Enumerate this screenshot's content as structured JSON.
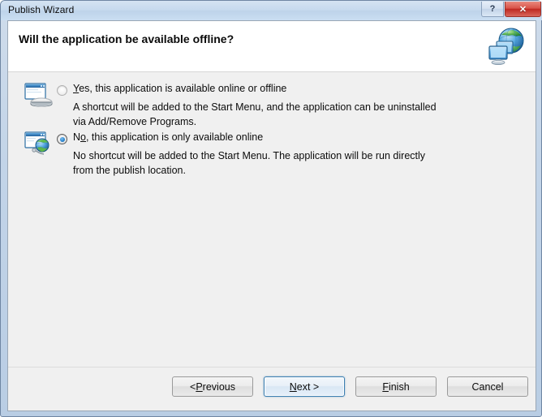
{
  "window": {
    "title": "Publish Wizard",
    "titlebar_buttons": [
      {
        "name": "help",
        "glyph": "?"
      },
      {
        "name": "close",
        "glyph": "✕"
      }
    ]
  },
  "header": {
    "title": "Will the application be available offline?",
    "icon": "network-globe-icon"
  },
  "options": [
    {
      "icon": "computer-disk-icon",
      "label_prefix": "",
      "label_accel": "Y",
      "label_rest": "es, this application is available online or offline",
      "description": "A shortcut will be added to the Start Menu, and the application can be uninstalled via Add/Remove Programs.",
      "selected": false
    },
    {
      "icon": "computer-globe-icon",
      "label_prefix": "N",
      "label_accel": "o",
      "label_rest": ", this application is only available online",
      "description": "No shortcut will be added to the Start Menu. The application will be run directly from the publish location.",
      "selected": true
    }
  ],
  "footer": {
    "buttons": [
      {
        "name": "previous",
        "prefix": "< ",
        "accel": "P",
        "rest": "revious",
        "default": false
      },
      {
        "name": "next",
        "prefix": "",
        "accel": "N",
        "rest": "ext >",
        "default": true
      },
      {
        "name": "finish",
        "prefix": "",
        "accel": "F",
        "rest": "inish",
        "default": false
      },
      {
        "name": "cancel",
        "prefix": "Cancel",
        "accel": "",
        "rest": "",
        "default": false
      }
    ]
  },
  "colors": {
    "titlebar": "#c6d9ee",
    "close_button": "#bf2a22",
    "client_background": "#f0f0f0",
    "header_background": "#ffffff",
    "default_button_border": "#3c7fb1",
    "radio_dot": "#2b86d0"
  }
}
